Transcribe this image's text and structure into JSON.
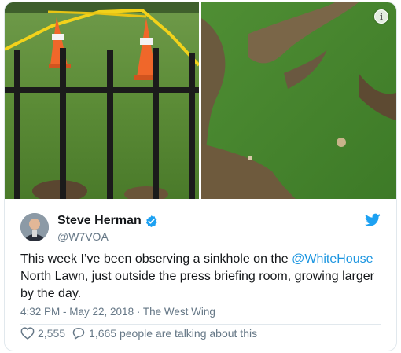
{
  "media": {
    "info_icon": "info-icon",
    "photos": [
      {
        "name": "fence-cones-photo"
      },
      {
        "name": "sinkhole-closeup-photo"
      }
    ]
  },
  "user": {
    "display_name": "Steve Herman",
    "handle": "@W7VOA",
    "verified_icon": "verified-badge-icon",
    "avatar": "avatar"
  },
  "tweet": {
    "text_before": "This week I’ve been observing a sinkhole on the ",
    "mention": "@WhiteHouse",
    "text_after": " North Lawn, just outside the press briefing room, growing larger by the day."
  },
  "meta": {
    "time": "4:32 PM - May 22, 2018",
    "separator": " · ",
    "location": "The West Wing"
  },
  "actions": {
    "like_count": "2,555",
    "reply_text": "1,665 people are talking about this"
  },
  "colors": {
    "link": "#1b95e0",
    "twitter_blue": "#1da1f2",
    "secondary_text": "#657786",
    "border": "#e1e8ed"
  }
}
